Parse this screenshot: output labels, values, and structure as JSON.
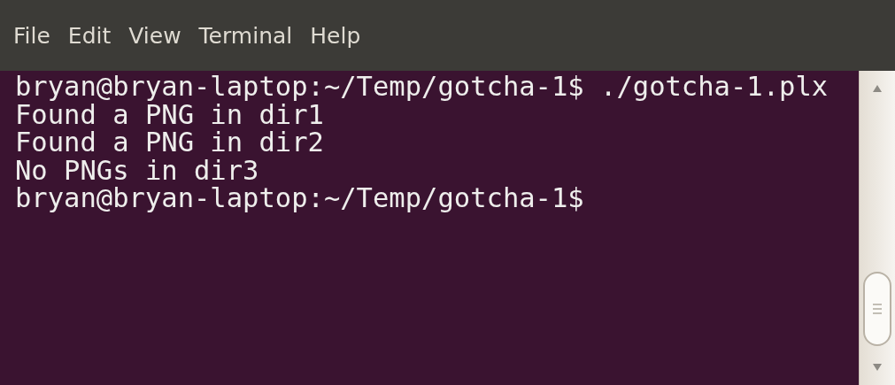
{
  "menu_bar": {
    "items": [
      "File",
      "Edit",
      "View",
      "Terminal",
      "Help"
    ]
  },
  "terminal": {
    "lines": [
      "bryan@bryan-laptop:~/Temp/gotcha-1$ ./gotcha-1.plx",
      "Found a PNG in dir1",
      "Found a PNG in dir2",
      "No PNGs in dir3",
      "bryan@bryan-laptop:~/Temp/gotcha-1$"
    ]
  }
}
